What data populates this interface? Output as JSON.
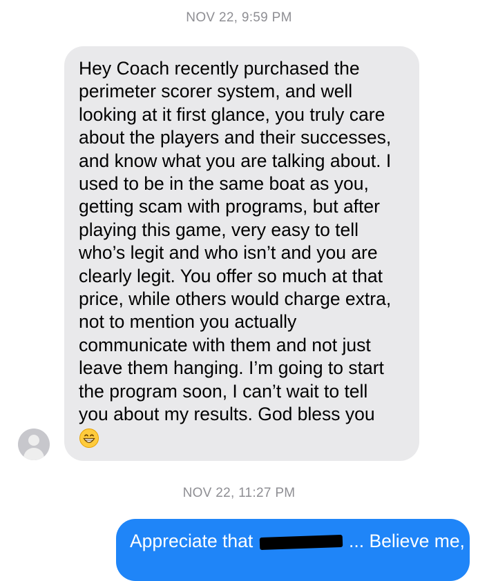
{
  "thread": {
    "timestamp_1": "NOV 22, 9:59 PM",
    "incoming_message": "Hey Coach recently purchased the\nperimeter scorer system, and well\nlooking at it first glance, you truly care\nabout the players and their successes,\nand know what you are talking about. I\nused to be in the same boat as you,\ngetting scam with programs, but after\nplaying this game, very easy to tell\nwho’s legit and who isn’t and you are\nclearly legit. You offer so much at that\nprice, while others would charge extra,\nnot to mention you actually\ncommunicate with them and not just\nleave them hanging. I’m going to start\nthe program soon, I can’t wait to tell\nyou about my results. God bless you",
    "incoming_emoji": "grinning-face-emoji",
    "timestamp_2": "NOV 22, 11:27 PM",
    "outgoing_message_start": "Appreciate that",
    "outgoing_message_end": "... Believe me,"
  },
  "colors": {
    "incoming_bubble": "#e9e9eb",
    "outgoing_bubble": "#1f85f8",
    "timestamp": "#8e8e93",
    "avatar": "#c7c7cc"
  }
}
